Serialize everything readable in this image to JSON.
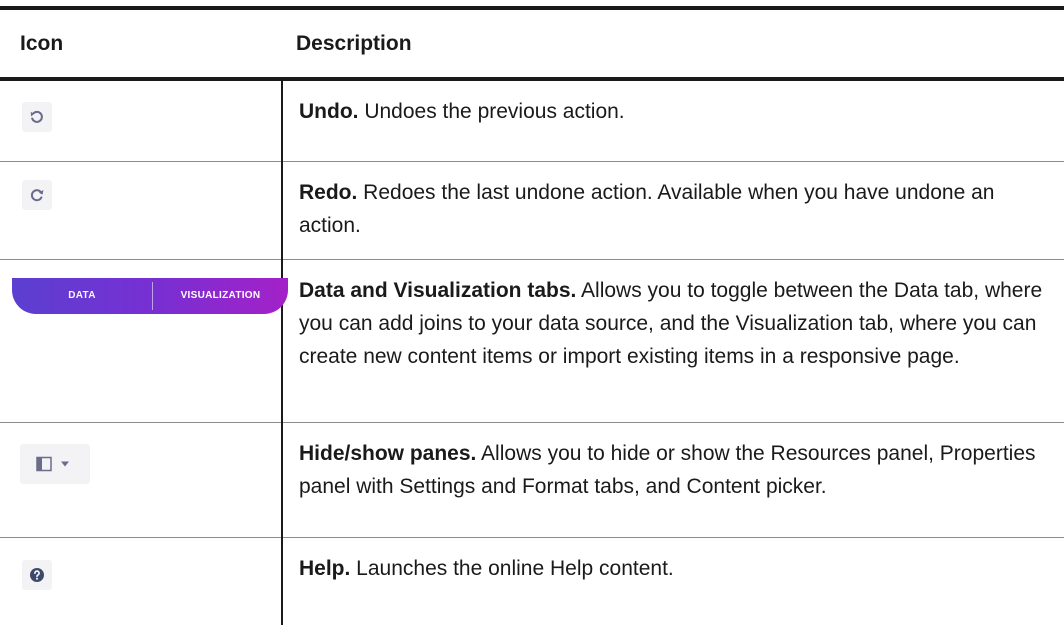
{
  "header": {
    "icon_col": "Icon",
    "desc_col": "Description"
  },
  "rows": [
    {
      "icon": "undo-icon",
      "title": "Undo.",
      "text": " Undoes the previous action."
    },
    {
      "icon": "redo-icon",
      "title": "Redo.",
      "text": " Redoes the last undone action. Available when you have undone an action."
    },
    {
      "icon": "data-visualization-tabs",
      "tabs": {
        "data_label": "DATA",
        "visualization_label": "VISUALIZATION"
      },
      "title": "Data and Visualization tabs.",
      "text": " Allows you to toggle between the Data tab, where you can add joins to your data source, and the Visualization tab, where you can create new content items or import existing items in a responsive page."
    },
    {
      "icon": "hide-show-panes-icon",
      "title": "Hide/show panes.",
      "text": " Allows you to hide or show the Resources panel, Properties panel with Settings and Format tabs, and Content picker."
    },
    {
      "icon": "help-icon",
      "title": "Help.",
      "text": " Launches the online Help content."
    }
  ],
  "colors": {
    "icon_gray": "#6b6b8a",
    "help_blue": "#3d4a6b",
    "tab_gradient_start": "#5b3fd1",
    "tab_gradient_end": "#a421c8"
  }
}
